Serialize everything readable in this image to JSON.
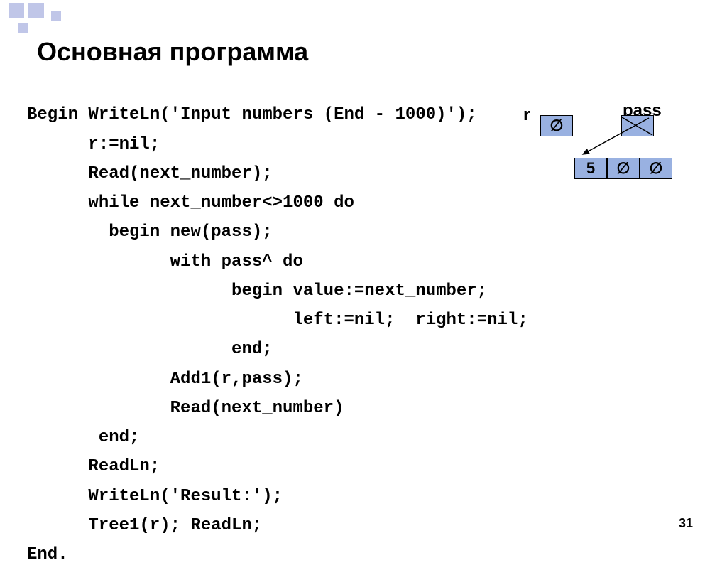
{
  "title": "Основная программа",
  "code": {
    "l1": "Begin WriteLn('Input numbers (End - 1000)');",
    "l2": "      r:=nil;",
    "l3": "      Read(next_number);",
    "l4": "      while next_number<>1000 do",
    "l5": "        begin new(pass);",
    "l6": "              with pass^ do",
    "l7": "                    begin value:=next_number;",
    "l8": "                          left:=nil;  right:=nil;",
    "l9": "                    end;",
    "l10": "              Add1(r,pass);",
    "l11": "              Read(next_number)",
    "l12": "       end;",
    "l13": "      ReadLn;",
    "l14": "      WriteLn('Result:');",
    "l15": "      Tree1(r); ReadLn;",
    "l16": "End."
  },
  "diagram": {
    "label_r": "r",
    "label_pass": "pass",
    "empty": "∅",
    "value": "5"
  },
  "pagenum": "31"
}
